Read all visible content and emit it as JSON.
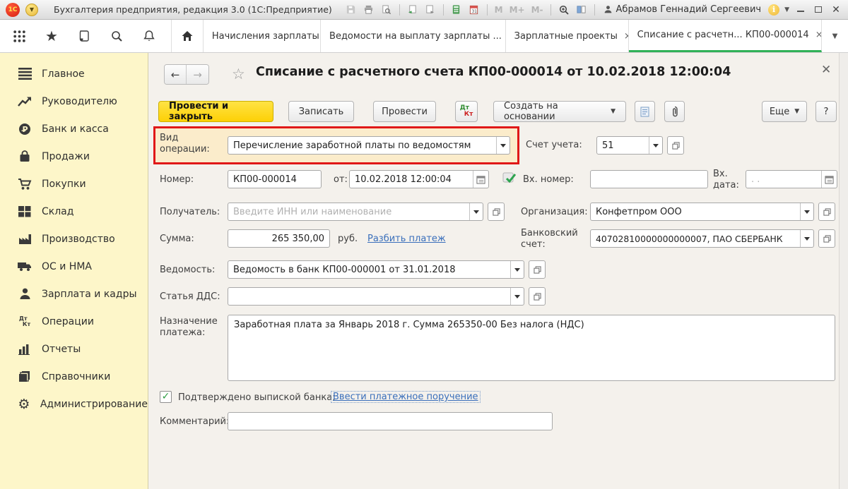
{
  "colors": {
    "accent_green": "#30b258",
    "sidebar_yellow": "#fdf6c9",
    "primary_button_yellow": "#ffd800",
    "annotation_red": "#e01818",
    "link_blue": "#3a6fbb"
  },
  "titlebar": {
    "title": "Бухгалтерия предприятия, редакция 3.0  (1С:Предприятие)",
    "user_name": "Абрамов Геннадий Сергеевич",
    "memory": {
      "m": "M",
      "m_plus": "M+",
      "m_minus": "M-"
    }
  },
  "tabbar": {
    "tabs": [
      {
        "label": "Начисления зарплаты"
      },
      {
        "label": "Ведомости на выплату зарплаты ..."
      },
      {
        "label": "Зарплатные проекты"
      },
      {
        "label": "Списание с расчетн... КП00-000014"
      }
    ]
  },
  "sidebar": {
    "items": [
      {
        "label": "Главное",
        "icon": "menu-lines-icon"
      },
      {
        "label": "Руководителю",
        "icon": "trend-arrow-icon"
      },
      {
        "label": "Банк и касса",
        "icon": "ruble-circle-icon"
      },
      {
        "label": "Продажи",
        "icon": "bag-icon"
      },
      {
        "label": "Покупки",
        "icon": "cart-icon"
      },
      {
        "label": "Склад",
        "icon": "warehouse-icon"
      },
      {
        "label": "Производство",
        "icon": "factory-icon"
      },
      {
        "label": "ОС и НМА",
        "icon": "truck-icon"
      },
      {
        "label": "Зарплата и кадры",
        "icon": "person-icon"
      },
      {
        "label": "Операции",
        "icon": "dtkt-icon"
      },
      {
        "label": "Отчеты",
        "icon": "bar-chart-icon"
      },
      {
        "label": "Справочники",
        "icon": "books-icon"
      },
      {
        "label": "Администрирование",
        "icon": "gear-icon"
      }
    ]
  },
  "doc": {
    "title": "Списание с расчетного счета КП00-000014 от 10.02.2018 12:00:04",
    "toolbar": {
      "post_and_close": "Провести и закрыть",
      "save": "Записать",
      "post": "Провести",
      "create_based_on": "Создать на основании",
      "more": "Еще",
      "help": "?"
    },
    "form": {
      "operation": {
        "label": "Вид операции:",
        "value": "Перечисление заработной платы по ведомостям"
      },
      "account": {
        "label": "Счет учета:",
        "value": "51"
      },
      "number": {
        "label": "Номер:",
        "value": "КП00-000014"
      },
      "date": {
        "label": "от:",
        "value": "10.02.2018 12:00:04"
      },
      "in_number": {
        "label": "Вх. номер:",
        "value": ""
      },
      "in_date": {
        "label": "Вх. дата:",
        "placeholder": ".  ."
      },
      "payee": {
        "label": "Получатель:",
        "placeholder": "Введите ИНН или наименование"
      },
      "organization": {
        "label": "Организация:",
        "value": "Конфетпром ООО"
      },
      "amount": {
        "label": "Сумма:",
        "value": "265 350,00",
        "currency": "руб.",
        "split_link": "Разбить платеж"
      },
      "bank_account": {
        "label": "Банковский счет:",
        "value": "40702810000000000007, ПАО СБЕРБАНК"
      },
      "sheet": {
        "label": "Ведомость:",
        "value": "Ведомость в банк КП00-000001 от 31.01.2018"
      },
      "dds": {
        "label": "Статья ДДС:",
        "value": ""
      },
      "purpose": {
        "label": "Назначение платежа:",
        "value": "Заработная плата за Январь 2018 г. Сумма 265350-00 Без налога (НДС)"
      },
      "confirmed": {
        "label": "Подтверждено выпиской банка:",
        "checked": true,
        "link": "Ввести платежное поручение"
      },
      "comment": {
        "label": "Комментарий:",
        "value": ""
      }
    }
  }
}
